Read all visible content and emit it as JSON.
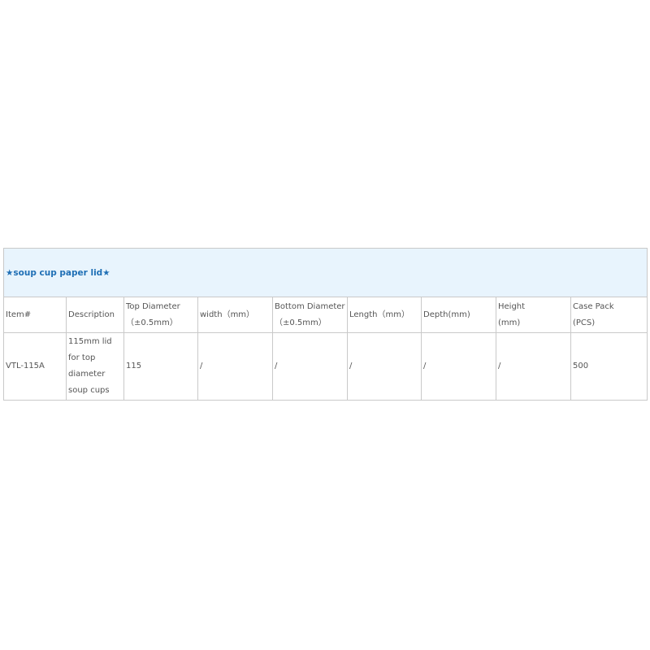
{
  "table": {
    "title": "★soup  cup paper lid★",
    "headers": [
      [
        "Item#"
      ],
      [
        "Description"
      ],
      [
        "Top Diameter",
        "（±0.5mm）"
      ],
      [
        "width（mm）"
      ],
      [
        "Bottom Diameter",
        "（±0.5mm）"
      ],
      [
        "Length（mm）"
      ],
      [
        "Depth(mm)"
      ],
      [
        "Height",
        "(mm)"
      ],
      [
        "Case Pack",
        "(PCS)"
      ]
    ],
    "rows": [
      [
        [
          "VTL-115A"
        ],
        [
          "115mm lid",
          "for top",
          "diameter",
          "soup cups"
        ],
        [
          "115"
        ],
        [
          "/"
        ],
        [
          "/"
        ],
        [
          "/"
        ],
        [
          "/"
        ],
        [
          "/"
        ],
        [
          "500"
        ]
      ]
    ]
  }
}
